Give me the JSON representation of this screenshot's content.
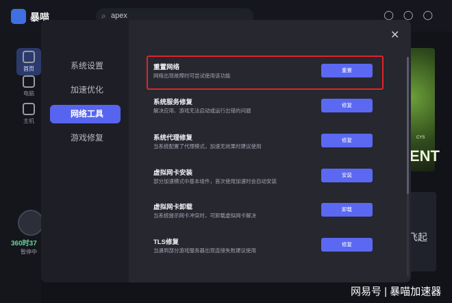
{
  "app": {
    "name": "暴喵"
  },
  "search": {
    "value": "apex"
  },
  "leftnav": {
    "items": [
      {
        "label": "首页"
      },
      {
        "label": "电脑"
      },
      {
        "label": "主机"
      }
    ]
  },
  "status": {
    "timer": "360时37",
    "state": "暂停中"
  },
  "bg_card": {
    "title": "ENT",
    "tag": "CYS",
    "text2": "飞起"
  },
  "dialog": {
    "sidebar": [
      {
        "label": "系统设置"
      },
      {
        "label": "加速优化"
      },
      {
        "label": "网络工具",
        "active": true
      },
      {
        "label": "游戏修复"
      }
    ],
    "close_icon": "close-icon",
    "rows": [
      {
        "title": "重置网络",
        "desc": "网络出现故障时可尝试使用该功能",
        "button": "重置",
        "highlighted": true
      },
      {
        "title": "系统服务修复",
        "desc": "解决应用、游戏无法启动或运行出错的问题",
        "button": "修复"
      },
      {
        "title": "系统代理修复",
        "desc": "当系统配置了代理模式，加速无效果时建议使用",
        "button": "修复"
      },
      {
        "title": "虚拟网卡安装",
        "desc": "部分加速模式中基本组件，首次使用加速时会自动安装",
        "button": "安装"
      },
      {
        "title": "虚拟网卡卸载",
        "desc": "当系统提示网卡冲突时，可卸载虚拟网卡解决",
        "button": "卸载"
      },
      {
        "title": "TLS修复",
        "desc": "当遇到部分游戏服务器出现连接失败建议使用",
        "button": "修复"
      }
    ]
  },
  "watermark": "网易号 | 暴喵加速器",
  "colors": {
    "accent": "#5b68f2",
    "highlight": "#e2242a",
    "dialog_bg": "#26272f"
  }
}
